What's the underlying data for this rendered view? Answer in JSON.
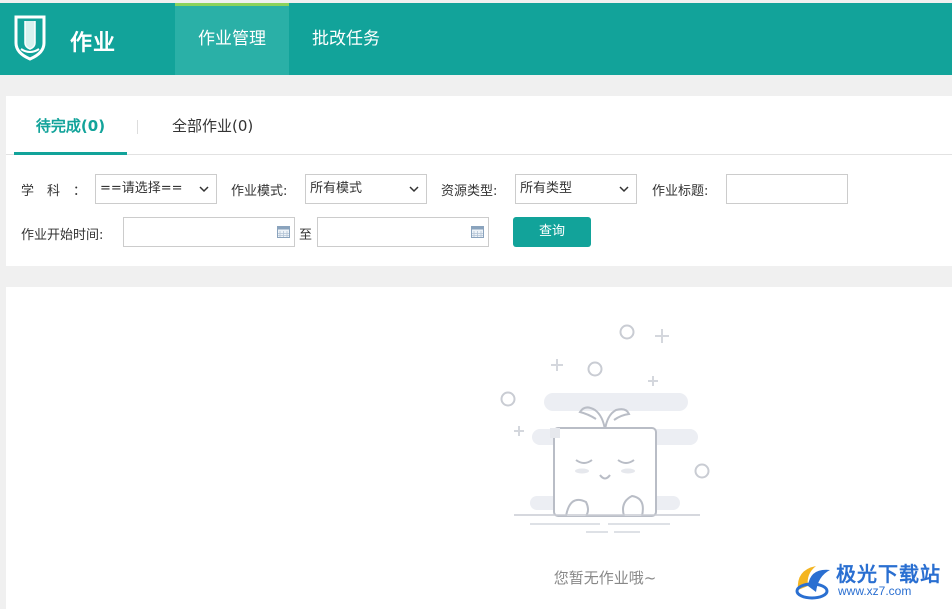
{
  "app": {
    "title": "作业"
  },
  "nav": {
    "items": [
      {
        "label": "作业管理",
        "active": true
      },
      {
        "label": "批改任务",
        "active": false
      }
    ]
  },
  "tabs": [
    {
      "label": "待完成(0)",
      "active": true
    },
    {
      "label": "全部作业(0)",
      "active": false
    }
  ],
  "filters": {
    "subject": {
      "label": "学　科　：",
      "value": "==请选择=="
    },
    "mode": {
      "label": "作业模式:",
      "value": "所有模式"
    },
    "resource": {
      "label": "资源类型:",
      "value": "所有类型"
    },
    "title": {
      "label": "作业标题:",
      "value": ""
    },
    "start_time": {
      "label": "作业开始时间:",
      "from_value": "",
      "to_label": "至",
      "to_value": ""
    },
    "query_label": "查询"
  },
  "empty_state": {
    "message": "您暂无作业哦~"
  },
  "watermark": {
    "line1": "极光下载站",
    "line2": "www.xz7.com"
  },
  "colors": {
    "primary": "#12a39a",
    "active_nav": "#2ab0a7",
    "accent_top": "#8bd25c"
  }
}
